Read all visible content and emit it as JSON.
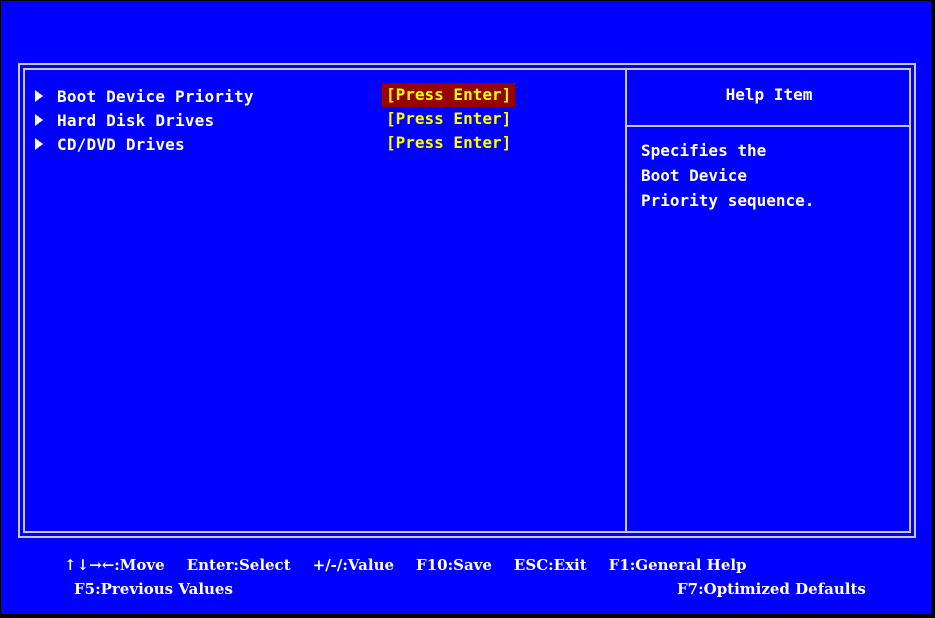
{
  "menu": {
    "items": [
      {
        "label": "Boot Device Priority",
        "value": "[Press Enter]",
        "selected": true
      },
      {
        "label": "Hard Disk Drives",
        "value": "[Press Enter]",
        "selected": false
      },
      {
        "label": "CD/DVD Drives",
        "value": "[Press Enter]",
        "selected": false
      }
    ]
  },
  "help": {
    "title": "Help Item",
    "text": "Specifies the\nBoot Device\nPriority sequence."
  },
  "footer": {
    "move": "↑↓→←:Move",
    "select": "Enter:Select",
    "value": "+/-/:Value",
    "save": "F10:Save",
    "exit": "ESC:Exit",
    "general_help": "F1:General Help",
    "previous_values": "F5:Previous Values",
    "optimized_defaults": "F7:Optimized Defaults"
  },
  "colors": {
    "background": "#0000FF",
    "frame": "#C8C8C8",
    "text": "#FFFFFF",
    "value_text": "#FFFF00",
    "highlight": "#990000"
  }
}
